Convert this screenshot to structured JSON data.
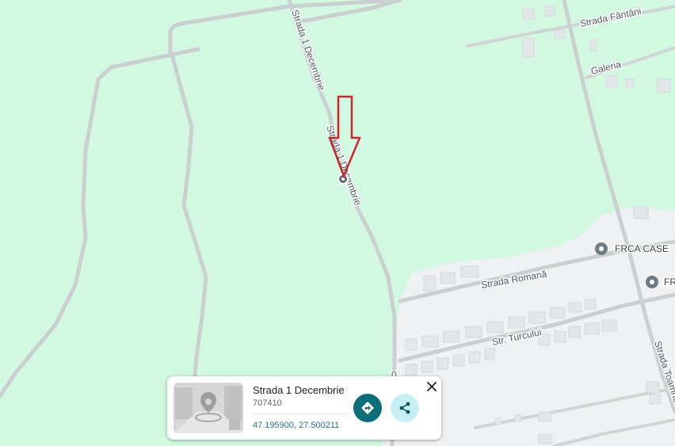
{
  "map": {
    "street_labels": {
      "strada_1_decembrie_north": "Strada 1 Decembrie",
      "strada_1_decembrie_marker": "Strada 1 Decembrie",
      "strada_fantani": "Strada Fântâni",
      "galeria": "Galeria",
      "strada_romana": "Strada Romană",
      "str_turcului": "Str. Turcului",
      "strada_toamnei": "Strada Toamnei"
    },
    "poi": [
      {
        "name": "FRCA CASE",
        "icon": "place-pin-icon"
      },
      {
        "name": "FR",
        "icon": "place-pin-icon"
      }
    ],
    "annotation": {
      "icon": "red-arrow-down-icon",
      "color": "#c8282a"
    },
    "colors": {
      "land": "#d3f8e2",
      "urban": "#eff1f3",
      "road": "#c9d0cf"
    }
  },
  "place_card": {
    "title": "Strada 1 Decembrie",
    "postal_code": "707410",
    "coordinates": "47.195900, 27.500211",
    "thumbnail_icon": "street-view-thumbnail",
    "directions_icon": "directions-icon",
    "share_icon": "share-icon",
    "close_icon": "close-icon",
    "accent_color": "#0b6e7a"
  }
}
